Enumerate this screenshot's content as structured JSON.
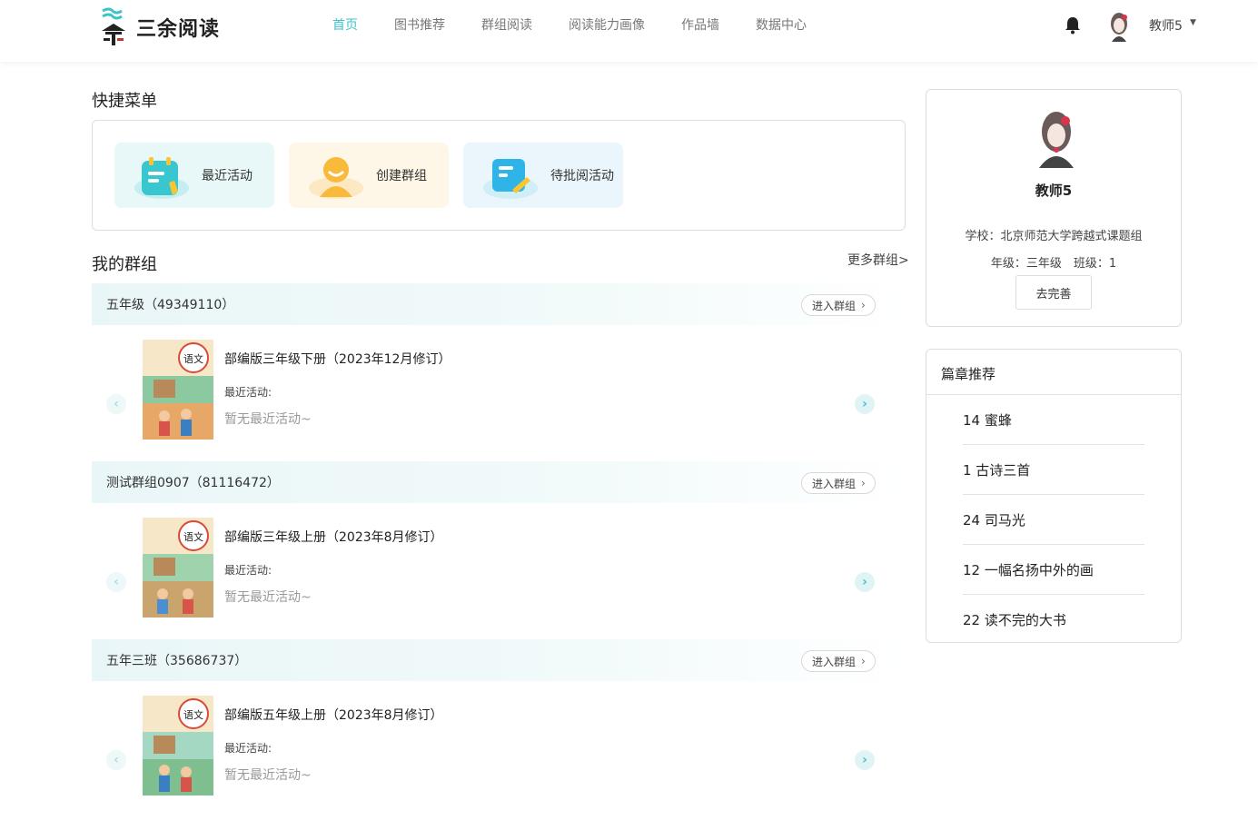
{
  "app": {
    "logo_text": "三余阅读"
  },
  "nav": {
    "items": [
      {
        "label": "首页",
        "active": true
      },
      {
        "label": "图书推荐",
        "active": false
      },
      {
        "label": "群组阅读",
        "active": false
      },
      {
        "label": "阅读能力画像",
        "active": false
      },
      {
        "label": "作品墙",
        "active": false
      },
      {
        "label": "数据中心",
        "active": false
      }
    ]
  },
  "header": {
    "username": "教师5"
  },
  "quick_menu": {
    "title": "快捷菜单",
    "items": [
      {
        "label": "最近活动",
        "icon": "recent-activity-icon",
        "bg": "#e8f8f8"
      },
      {
        "label": "创建群组",
        "icon": "create-group-icon",
        "bg": "#fef7e8"
      },
      {
        "label": "待批阅活动",
        "icon": "pending-review-icon",
        "bg": "#eaf6fb"
      }
    ]
  },
  "groups": {
    "title": "我的群组",
    "more_label": "更多群组>",
    "enter_label": "进入群组",
    "recent_label": "最近活动:",
    "empty_label": "暂无最近活动~",
    "items": [
      {
        "name": "五年级（49349110）",
        "book": "部编版三年级下册（2023年12月修订）"
      },
      {
        "name": "测试群组0907（81116472）",
        "book": "部编版三年级上册（2023年8月修订）"
      },
      {
        "name": "五年三班（35686737）",
        "book": "部编版五年级上册（2023年8月修订）"
      }
    ]
  },
  "profile": {
    "name": "教师5",
    "school": "学校：北京师范大学跨越式课题组",
    "grade_class": "年级：三年级　班级：1",
    "complete_label": "去完善"
  },
  "recommend": {
    "title": "篇章推荐",
    "items": [
      "14 蜜蜂",
      "1 古诗三首",
      "24 司马光",
      "12 一幅名扬中外的画",
      "22 读不完的大书"
    ]
  },
  "colors": {
    "accent": "#3ec3c8"
  }
}
